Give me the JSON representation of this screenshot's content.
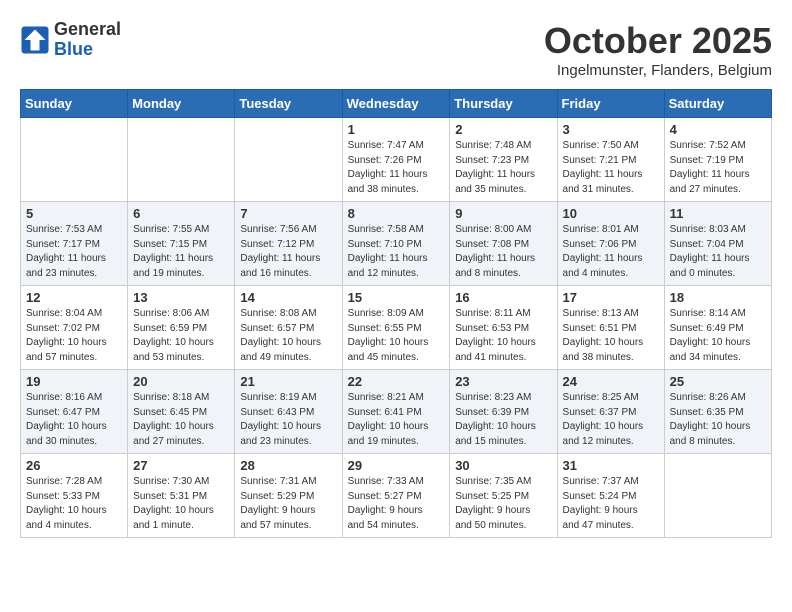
{
  "logo": {
    "general": "General",
    "blue": "Blue"
  },
  "title": "October 2025",
  "location": "Ingelmunster, Flanders, Belgium",
  "days_of_week": [
    "Sunday",
    "Monday",
    "Tuesday",
    "Wednesday",
    "Thursday",
    "Friday",
    "Saturday"
  ],
  "weeks": [
    [
      {
        "day": "",
        "info": ""
      },
      {
        "day": "",
        "info": ""
      },
      {
        "day": "",
        "info": ""
      },
      {
        "day": "1",
        "info": "Sunrise: 7:47 AM\nSunset: 7:26 PM\nDaylight: 11 hours\nand 38 minutes."
      },
      {
        "day": "2",
        "info": "Sunrise: 7:48 AM\nSunset: 7:23 PM\nDaylight: 11 hours\nand 35 minutes."
      },
      {
        "day": "3",
        "info": "Sunrise: 7:50 AM\nSunset: 7:21 PM\nDaylight: 11 hours\nand 31 minutes."
      },
      {
        "day": "4",
        "info": "Sunrise: 7:52 AM\nSunset: 7:19 PM\nDaylight: 11 hours\nand 27 minutes."
      }
    ],
    [
      {
        "day": "5",
        "info": "Sunrise: 7:53 AM\nSunset: 7:17 PM\nDaylight: 11 hours\nand 23 minutes."
      },
      {
        "day": "6",
        "info": "Sunrise: 7:55 AM\nSunset: 7:15 PM\nDaylight: 11 hours\nand 19 minutes."
      },
      {
        "day": "7",
        "info": "Sunrise: 7:56 AM\nSunset: 7:12 PM\nDaylight: 11 hours\nand 16 minutes."
      },
      {
        "day": "8",
        "info": "Sunrise: 7:58 AM\nSunset: 7:10 PM\nDaylight: 11 hours\nand 12 minutes."
      },
      {
        "day": "9",
        "info": "Sunrise: 8:00 AM\nSunset: 7:08 PM\nDaylight: 11 hours\nand 8 minutes."
      },
      {
        "day": "10",
        "info": "Sunrise: 8:01 AM\nSunset: 7:06 PM\nDaylight: 11 hours\nand 4 minutes."
      },
      {
        "day": "11",
        "info": "Sunrise: 8:03 AM\nSunset: 7:04 PM\nDaylight: 11 hours\nand 0 minutes."
      }
    ],
    [
      {
        "day": "12",
        "info": "Sunrise: 8:04 AM\nSunset: 7:02 PM\nDaylight: 10 hours\nand 57 minutes."
      },
      {
        "day": "13",
        "info": "Sunrise: 8:06 AM\nSunset: 6:59 PM\nDaylight: 10 hours\nand 53 minutes."
      },
      {
        "day": "14",
        "info": "Sunrise: 8:08 AM\nSunset: 6:57 PM\nDaylight: 10 hours\nand 49 minutes."
      },
      {
        "day": "15",
        "info": "Sunrise: 8:09 AM\nSunset: 6:55 PM\nDaylight: 10 hours\nand 45 minutes."
      },
      {
        "day": "16",
        "info": "Sunrise: 8:11 AM\nSunset: 6:53 PM\nDaylight: 10 hours\nand 41 minutes."
      },
      {
        "day": "17",
        "info": "Sunrise: 8:13 AM\nSunset: 6:51 PM\nDaylight: 10 hours\nand 38 minutes."
      },
      {
        "day": "18",
        "info": "Sunrise: 8:14 AM\nSunset: 6:49 PM\nDaylight: 10 hours\nand 34 minutes."
      }
    ],
    [
      {
        "day": "19",
        "info": "Sunrise: 8:16 AM\nSunset: 6:47 PM\nDaylight: 10 hours\nand 30 minutes."
      },
      {
        "day": "20",
        "info": "Sunrise: 8:18 AM\nSunset: 6:45 PM\nDaylight: 10 hours\nand 27 minutes."
      },
      {
        "day": "21",
        "info": "Sunrise: 8:19 AM\nSunset: 6:43 PM\nDaylight: 10 hours\nand 23 minutes."
      },
      {
        "day": "22",
        "info": "Sunrise: 8:21 AM\nSunset: 6:41 PM\nDaylight: 10 hours\nand 19 minutes."
      },
      {
        "day": "23",
        "info": "Sunrise: 8:23 AM\nSunset: 6:39 PM\nDaylight: 10 hours\nand 15 minutes."
      },
      {
        "day": "24",
        "info": "Sunrise: 8:25 AM\nSunset: 6:37 PM\nDaylight: 10 hours\nand 12 minutes."
      },
      {
        "day": "25",
        "info": "Sunrise: 8:26 AM\nSunset: 6:35 PM\nDaylight: 10 hours\nand 8 minutes."
      }
    ],
    [
      {
        "day": "26",
        "info": "Sunrise: 7:28 AM\nSunset: 5:33 PM\nDaylight: 10 hours\nand 4 minutes."
      },
      {
        "day": "27",
        "info": "Sunrise: 7:30 AM\nSunset: 5:31 PM\nDaylight: 10 hours\nand 1 minute."
      },
      {
        "day": "28",
        "info": "Sunrise: 7:31 AM\nSunset: 5:29 PM\nDaylight: 9 hours\nand 57 minutes."
      },
      {
        "day": "29",
        "info": "Sunrise: 7:33 AM\nSunset: 5:27 PM\nDaylight: 9 hours\nand 54 minutes."
      },
      {
        "day": "30",
        "info": "Sunrise: 7:35 AM\nSunset: 5:25 PM\nDaylight: 9 hours\nand 50 minutes."
      },
      {
        "day": "31",
        "info": "Sunrise: 7:37 AM\nSunset: 5:24 PM\nDaylight: 9 hours\nand 47 minutes."
      },
      {
        "day": "",
        "info": ""
      }
    ]
  ]
}
